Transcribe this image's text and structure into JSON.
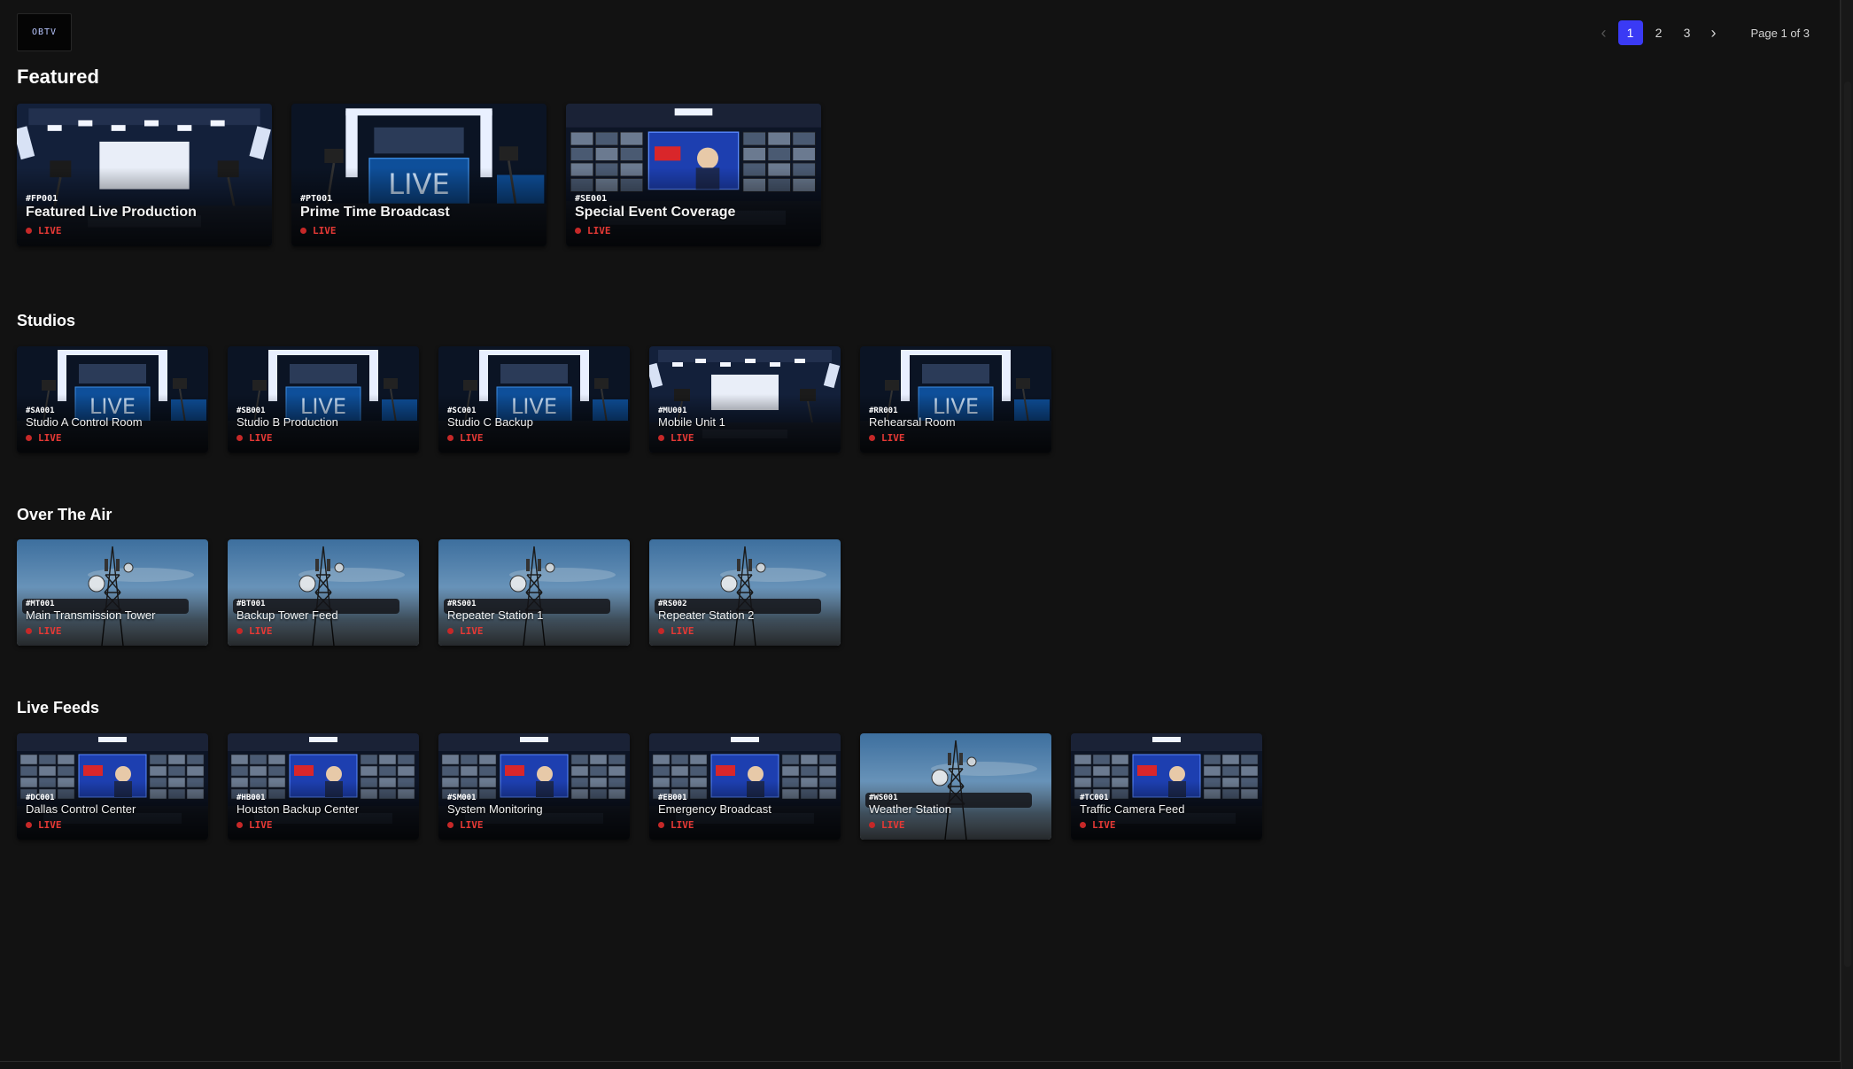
{
  "app": {
    "logo_text": "OBTV"
  },
  "pagination": {
    "prev_icon": "‹",
    "next_icon": "›",
    "pages": [
      "1",
      "2",
      "3"
    ],
    "current_page": "1",
    "info": "Page 1 of 3"
  },
  "live_label": "LIVE",
  "colors": {
    "accent": "#3a3af5",
    "live": "#e53935",
    "background": "#121212"
  },
  "sections": {
    "featured": {
      "title": "Featured",
      "cards": [
        {
          "id": "#FP001",
          "name": "Featured Live Production",
          "scene": "studio-floor"
        },
        {
          "id": "#PT001",
          "name": "Prime Time Broadcast",
          "scene": "studio-live"
        },
        {
          "id": "#SE001",
          "name": "Special Event Coverage",
          "scene": "control-room"
        }
      ]
    },
    "studios": {
      "title": "Studios",
      "cards": [
        {
          "id": "#SA001",
          "name": "Studio A Control Room",
          "scene": "studio-live"
        },
        {
          "id": "#SB001",
          "name": "Studio B Production",
          "scene": "studio-live"
        },
        {
          "id": "#SC001",
          "name": "Studio C Backup",
          "scene": "studio-live"
        },
        {
          "id": "#MU001",
          "name": "Mobile Unit 1",
          "scene": "studio-floor"
        },
        {
          "id": "#RR001",
          "name": "Rehearsal Room",
          "scene": "studio-live"
        }
      ]
    },
    "over_the_air": {
      "title": "Over The Air",
      "cards": [
        {
          "id": "#MT001",
          "name": "Main Transmission Tower",
          "scene": "tower"
        },
        {
          "id": "#BT001",
          "name": "Backup Tower Feed",
          "scene": "tower"
        },
        {
          "id": "#RS001",
          "name": "Repeater Station 1",
          "scene": "tower"
        },
        {
          "id": "#RS002",
          "name": "Repeater Station 2",
          "scene": "tower"
        }
      ]
    },
    "live_feeds": {
      "title": "Live Feeds",
      "cards": [
        {
          "id": "#DC001",
          "name": "Dallas Control Center",
          "scene": "control-room"
        },
        {
          "id": "#HB001",
          "name": "Houston Backup Center",
          "scene": "control-room"
        },
        {
          "id": "#SM001",
          "name": "System Monitoring",
          "scene": "control-room"
        },
        {
          "id": "#EB001",
          "name": "Emergency Broadcast",
          "scene": "control-room"
        },
        {
          "id": "#WS001",
          "name": "Weather Station",
          "scene": "tower"
        },
        {
          "id": "#TC001",
          "name": "Traffic Camera Feed",
          "scene": "control-room"
        }
      ]
    }
  }
}
